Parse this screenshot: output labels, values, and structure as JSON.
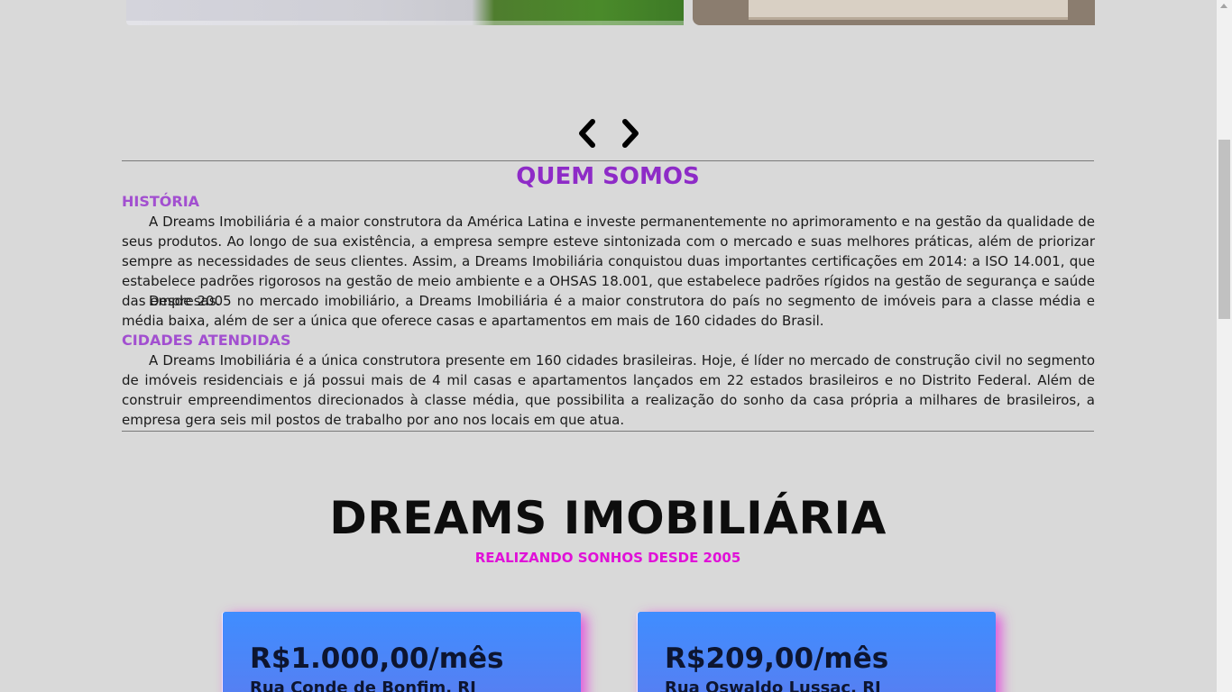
{
  "carousel": {
    "prev_icon": "chevron-left-icon",
    "next_icon": "chevron-right-icon"
  },
  "about": {
    "title": "QUEM SOMOS",
    "history_heading": "HISTÓRIA",
    "history_p1": "A Dreams Imobiliária é a maior construtora da América Latina e investe permanentemente no aprimoramento e na gestão da qualidade de seus produtos. Ao longo de sua existência, a empresa sempre esteve sintonizada com o mercado e suas melhores práticas, além de priorizar sempre as necessidades de seus clientes. Assim, a Dreams Imobiliária conquistou duas importantes certificações em 2014: a ISO 14.001, que estabelece padrões rigorosos na gestão de meio ambiente e a OHSAS 18.001, que estabelece padrões rígidos na gestão de segurança e saúde das empresas.",
    "history_p2": "Desde 2005 no mercado imobiliário, a Dreams Imobiliária é a maior construtora do país no segmento de imóveis para a classe média e média baixa, além de ser a única que oferece casas e apartamentos em mais de 160 cidades do Brasil.",
    "cities_heading": "CIDADES ATENDIDAS",
    "cities_p1": "A Dreams Imobiliária é a única construtora presente em 160 cidades brasileiras. Hoje, é líder no mercado de construção civil no segmento de imóveis residenciais e já possui mais de 4 mil casas e apartamentos lançados em 22 estados brasileiros e no Distrito Federal. Além de construir empreendimentos direcionados à classe média, que possibilita a realização do sonho da casa própria a milhares de brasileiros, a empresa gera seis mil postos de trabalho por ano nos locais em que atua."
  },
  "brand": {
    "name": "DREAMS IMOBILIÁRIA",
    "tagline": "REALIZANDO SONHOS DESDE 2005"
  },
  "listings": [
    {
      "price": "R$1.000,00/mês",
      "address": "Rua Conde de Bonfim, RJ"
    },
    {
      "price": "R$209,00/mês",
      "address": "Rua Oswaldo Lussac, RJ"
    }
  ],
  "colors": {
    "background": "#d9d9d9",
    "section_title": "#8e2bc7",
    "sub_heading": "#a24fd0",
    "tagline": "#e010d8",
    "card_blue": "#3f8dff",
    "card_glow": "#e628dc"
  }
}
